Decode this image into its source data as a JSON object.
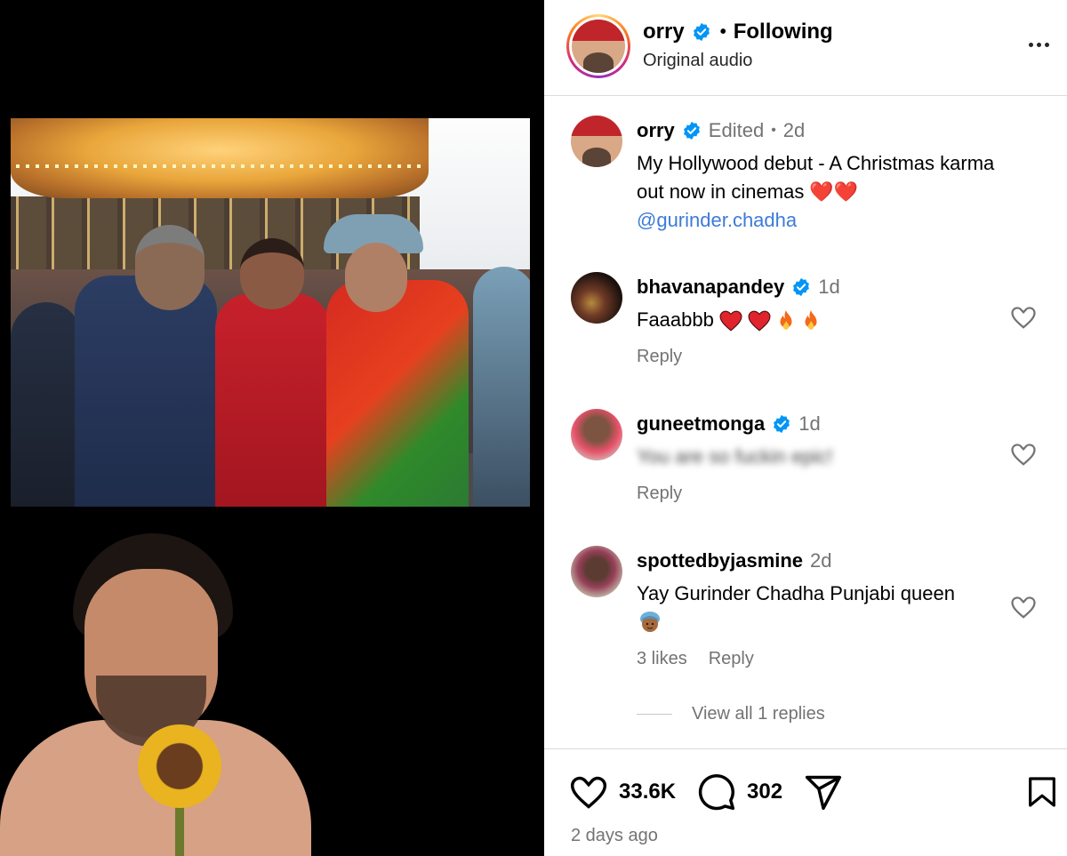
{
  "header": {
    "username": "orry",
    "separator": "•",
    "follow_status": "Following",
    "audio_label": "Original audio"
  },
  "caption": {
    "username": "orry",
    "edited_label": "Edited",
    "separator": "•",
    "age": "2d",
    "text": "My Hollywood debut - A Christmas karma out now in cinemas ❤️❤️",
    "mention": "@gurinder.chadha"
  },
  "comments": [
    {
      "username": "bhavanapandey",
      "age": "1d",
      "text": "Faaabbb",
      "reply_label": "Reply"
    },
    {
      "username": "guneetmonga",
      "age": "1d",
      "text": "You are so fuckin epic!",
      "reply_label": "Reply"
    },
    {
      "username": "spottedbyjasmine",
      "age": "2d",
      "text": "Yay Gurinder Chadha Punjabi queen",
      "likes_label": "3 likes",
      "reply_label": "Reply",
      "view_replies_label": "View all 1 replies"
    }
  ],
  "footer": {
    "likes_count": "33.6K",
    "comments_count": "302",
    "posted_time": "2 days ago"
  },
  "colors": {
    "verified_blue": "#0095f6",
    "heart_red": "#e0242c",
    "mention_blue": "#3d7bd9",
    "secondary_text": "#737373"
  },
  "icons": [
    "verified-icon",
    "more-options-icon",
    "heart-icon",
    "comment-icon",
    "share-icon",
    "bookmark-icon",
    "fire-emoji-icon",
    "red-heart-emoji-icon",
    "turban-woman-emoji-icon"
  ]
}
